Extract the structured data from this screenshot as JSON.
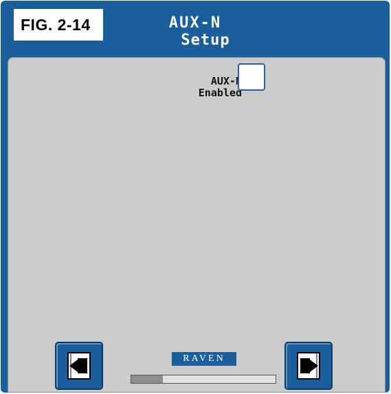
{
  "figure_label": "FIG. 2-14",
  "header": {
    "title_line1": "AUX-N",
    "title_line2": "Setup"
  },
  "form": {
    "aux_label_line1": "AUX-N",
    "aux_label_line2": "Enabled",
    "aux_enabled": false
  },
  "footer": {
    "back_icon": "arrow-left-page-icon",
    "next_icon": "arrow-right-page-icon",
    "brand": "RAVEN",
    "progress_fraction": 0.22
  },
  "colors": {
    "header_blue": "#1a5f9c",
    "panel_gray": "#cbcbcb",
    "checkbox_border": "#2563a6"
  }
}
